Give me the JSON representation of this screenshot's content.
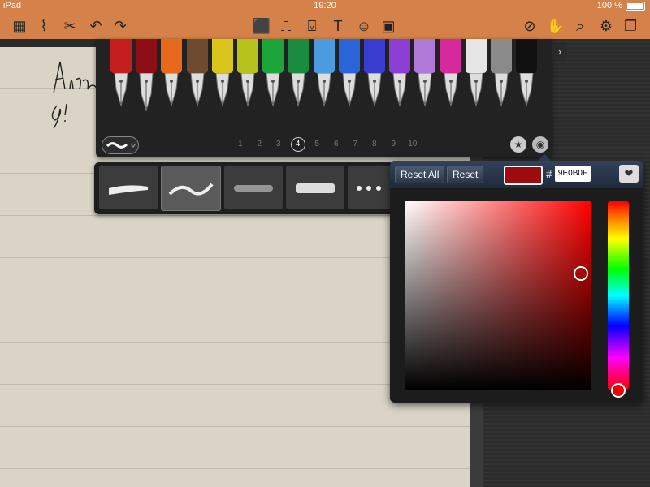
{
  "status": {
    "device": "iPad",
    "time": "19:20",
    "battery": "100 %"
  },
  "toolbar": {
    "icons": [
      "grid-icon",
      "broom-icon",
      "scissors-icon",
      "undo-icon",
      "redo-icon",
      "pen-icon",
      "highlighter-icon",
      "marker-icon",
      "text-icon",
      "emoji-icon",
      "image-icon",
      "compass-icon",
      "hand-icon",
      "search-icon",
      "gear-icon",
      "pages-icon"
    ]
  },
  "handwriting": {
    "line1": "Alan",
    "line2": "g!"
  },
  "pen_tray": {
    "pen_colors": [
      "#c41e1e",
      "#8b0f14",
      "#e8691b",
      "#6e4a2e",
      "#d9c61c",
      "#b6c21b",
      "#1ea53a",
      "#1a8a3e",
      "#4a9be0",
      "#2a64d8",
      "#3a3ed0",
      "#8a3ed4",
      "#b07ad8",
      "#d42a9c",
      "#e6e6e6",
      "#8a8a8a",
      "#111111"
    ],
    "pages": [
      "1",
      "2",
      "3",
      "4",
      "5",
      "6",
      "7",
      "8",
      "9",
      "10"
    ],
    "active_page": "4",
    "arrow": "›"
  },
  "color_picker": {
    "reset_all_label": "Reset All",
    "reset_label": "Reset",
    "hash": "#",
    "hex_value": "9E0B0F",
    "current_color": "#9e0b0f"
  }
}
